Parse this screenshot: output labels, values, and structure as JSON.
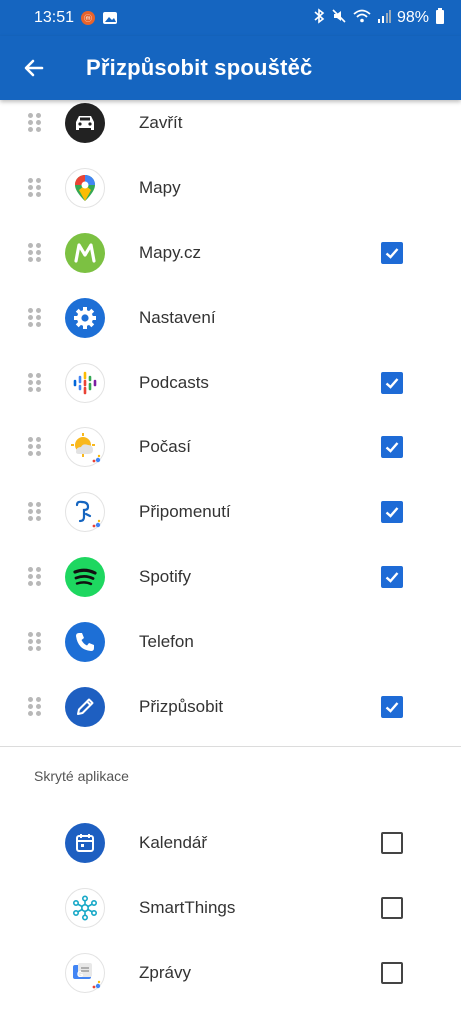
{
  "status": {
    "time": "13:51",
    "battery": "98%"
  },
  "appbar": {
    "title": "Přizpůsobit spouštěč"
  },
  "visible_apps": [
    {
      "label": "Zavřít",
      "icon": "car-icon",
      "checked": false
    },
    {
      "label": "Mapy",
      "icon": "google-maps-icon",
      "checked": false
    },
    {
      "label": "Mapy.cz",
      "icon": "mapy-cz-icon",
      "checked": true
    },
    {
      "label": "Nastavení",
      "icon": "settings-gear-icon",
      "checked": false
    },
    {
      "label": "Podcasts",
      "icon": "podcasts-icon",
      "checked": true
    },
    {
      "label": "Počasí",
      "icon": "weather-icon",
      "checked": true
    },
    {
      "label": "Připomenutí",
      "icon": "reminder-icon",
      "checked": true
    },
    {
      "label": "Spotify",
      "icon": "spotify-icon",
      "checked": true
    },
    {
      "label": "Telefon",
      "icon": "phone-icon",
      "checked": false
    },
    {
      "label": "Přizpůsobit",
      "icon": "pencil-icon",
      "checked": true
    }
  ],
  "hidden_section": {
    "title": "Skryté aplikace"
  },
  "hidden_apps": [
    {
      "label": "Kalendář",
      "icon": "calendar-icon",
      "checked": false
    },
    {
      "label": "SmartThings",
      "icon": "smartthings-icon",
      "checked": false
    },
    {
      "label": "Zprávy",
      "icon": "messages-icon",
      "checked": false
    }
  ],
  "colors": {
    "appbar": "#1565c0",
    "checkbox": "#1e6bd6"
  }
}
